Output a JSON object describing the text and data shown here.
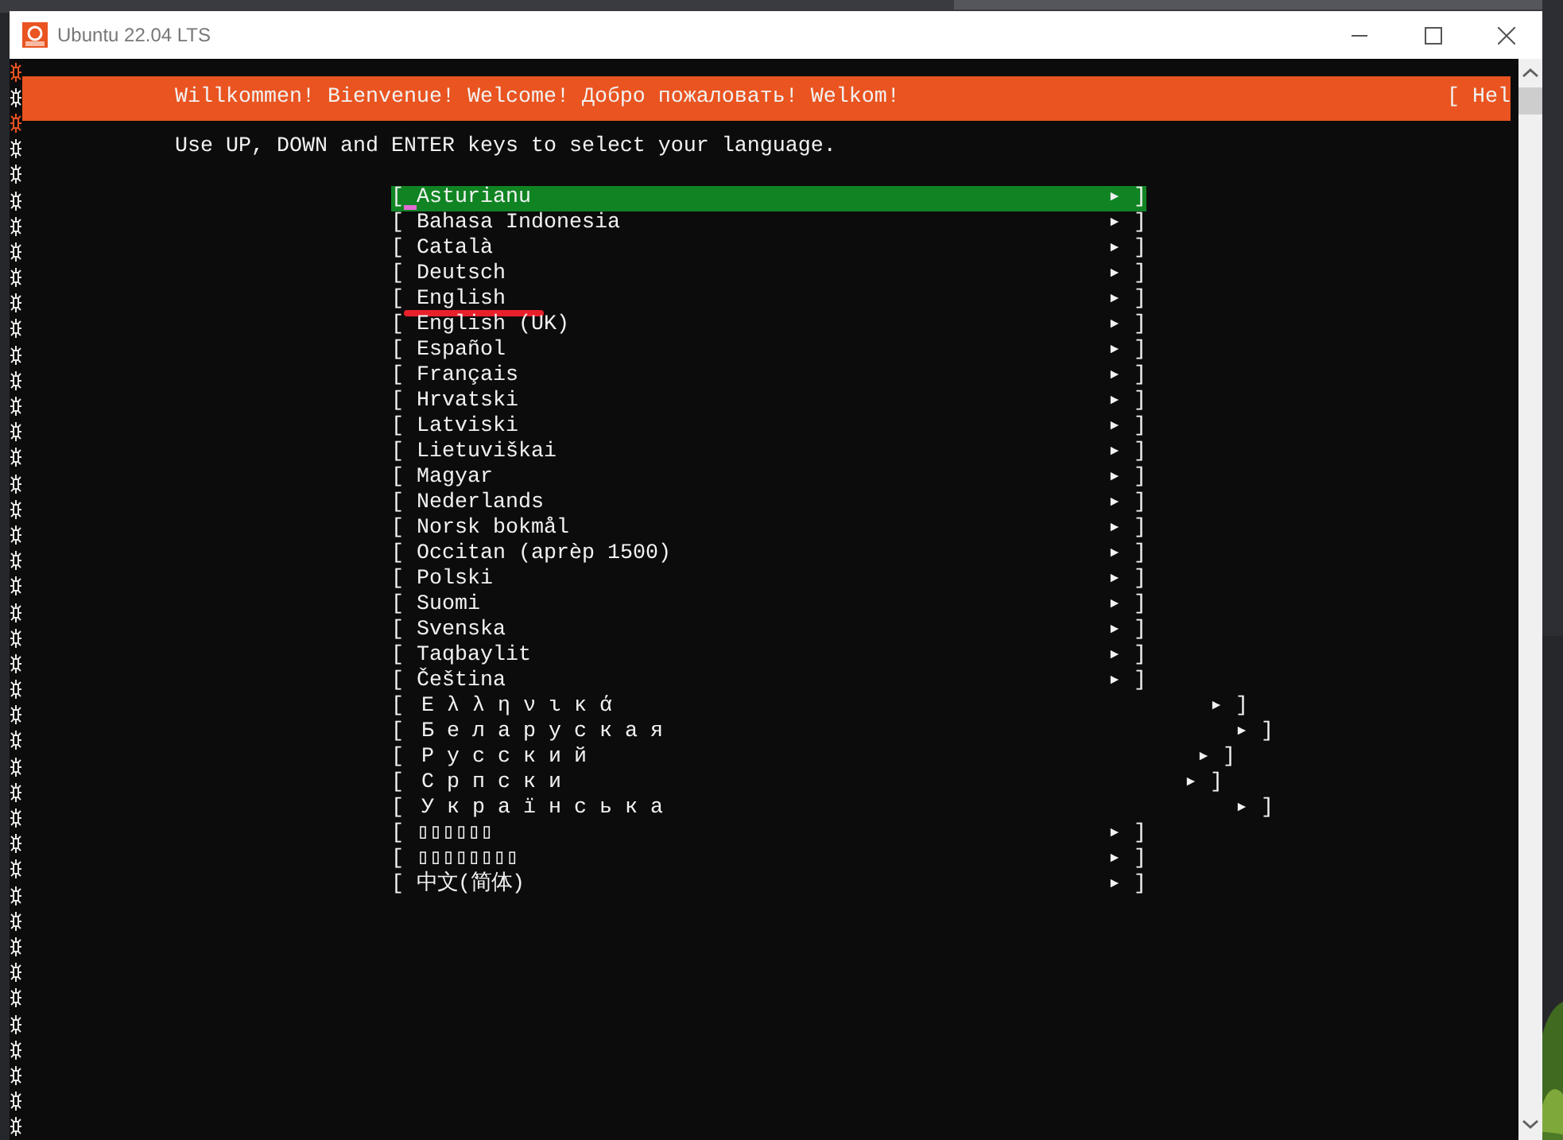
{
  "window": {
    "title": "Ubuntu 22.04 LTS"
  },
  "header": {
    "text": "Willkommen! Bienvenue! Welcome! Добро пожаловать! Welkom!",
    "help": "[ Hel"
  },
  "instruction": "Use UP, DOWN and ENTER keys to select your language.",
  "languages": [
    {
      "left": "[",
      "label": "Asturianu",
      "arrow": "▸",
      "right": "]",
      "kind": "normal",
      "selected": true,
      "underlined": false
    },
    {
      "left": "[",
      "label": "Bahasa Indonesia",
      "arrow": "▸",
      "right": "]",
      "kind": "normal",
      "selected": false,
      "underlined": false
    },
    {
      "left": "[",
      "label": "Català",
      "arrow": "▸",
      "right": "]",
      "kind": "normal",
      "selected": false,
      "underlined": false
    },
    {
      "left": "[",
      "label": "Deutsch",
      "arrow": "▸",
      "right": "]",
      "kind": "normal",
      "selected": false,
      "underlined": false
    },
    {
      "left": "[",
      "label": "English",
      "arrow": "▸",
      "right": "]",
      "kind": "normal",
      "selected": false,
      "underlined": true
    },
    {
      "left": "[",
      "label": "English (UK)",
      "arrow": "▸",
      "right": "]",
      "kind": "normal",
      "selected": false,
      "underlined": false
    },
    {
      "left": "[",
      "label": "Español",
      "arrow": "▸",
      "right": "]",
      "kind": "normal",
      "selected": false,
      "underlined": false
    },
    {
      "left": "[",
      "label": "Français",
      "arrow": "▸",
      "right": "]",
      "kind": "normal",
      "selected": false,
      "underlined": false
    },
    {
      "left": "[",
      "label": "Hrvatski",
      "arrow": "▸",
      "right": "]",
      "kind": "normal",
      "selected": false,
      "underlined": false
    },
    {
      "left": "[",
      "label": "Latviski",
      "arrow": "▸",
      "right": "]",
      "kind": "normal",
      "selected": false,
      "underlined": false
    },
    {
      "left": "[",
      "label": "Lietuviškai",
      "arrow": "▸",
      "right": "]",
      "kind": "normal",
      "selected": false,
      "underlined": false
    },
    {
      "left": "[",
      "label": "Magyar",
      "arrow": "▸",
      "right": "]",
      "kind": "normal",
      "selected": false,
      "underlined": false
    },
    {
      "left": "[",
      "label": "Nederlands",
      "arrow": "▸",
      "right": "]",
      "kind": "normal",
      "selected": false,
      "underlined": false
    },
    {
      "left": "[",
      "label": "Norsk bokmål",
      "arrow": "▸",
      "right": "]",
      "kind": "normal",
      "selected": false,
      "underlined": false
    },
    {
      "left": "[",
      "label": "Occitan (aprèp 1500)",
      "arrow": "▸",
      "right": "]",
      "kind": "normal",
      "selected": false,
      "underlined": false
    },
    {
      "left": "[",
      "label": "Polski",
      "arrow": "▸",
      "right": "]",
      "kind": "normal",
      "selected": false,
      "underlined": false
    },
    {
      "left": "[",
      "label": "Suomi",
      "arrow": "▸",
      "right": "]",
      "kind": "normal",
      "selected": false,
      "underlined": false
    },
    {
      "left": "[",
      "label": "Svenska",
      "arrow": "▸",
      "right": "]",
      "kind": "normal",
      "selected": false,
      "underlined": false
    },
    {
      "left": "[",
      "label": "Taqbaylit",
      "arrow": "▸",
      "right": "]",
      "kind": "normal",
      "selected": false,
      "underlined": false
    },
    {
      "left": "[",
      "label": "Čeština",
      "arrow": "▸",
      "right": "]",
      "kind": "normal",
      "selected": false,
      "underlined": false
    },
    {
      "left": "[",
      "label": "Ελληνικά",
      "arrow": "▸",
      "right": "]",
      "kind": "wide",
      "selected": false,
      "underlined": false
    },
    {
      "left": "[",
      "label": "Беларуская",
      "arrow": "▸",
      "right": "]",
      "kind": "wide",
      "selected": false,
      "underlined": false
    },
    {
      "left": "[",
      "label": "Русский",
      "arrow": "▸",
      "right": "]",
      "kind": "wide",
      "selected": false,
      "underlined": false
    },
    {
      "left": "[",
      "label": "Српски",
      "arrow": "▸",
      "right": "]",
      "kind": "wide",
      "selected": false,
      "underlined": false
    },
    {
      "left": "[",
      "label": "Українська",
      "arrow": "▸",
      "right": "]",
      "kind": "wide",
      "selected": false,
      "underlined": false
    },
    {
      "left": "[",
      "label": "▯▯▯▯▯▯",
      "arrow": "▸",
      "right": "]",
      "kind": "normal",
      "selected": false,
      "underlined": false
    },
    {
      "left": "[",
      "label": "▯▯▯▯▯▯▯▯",
      "arrow": "▸",
      "right": "]",
      "kind": "normal",
      "selected": false,
      "underlined": false
    },
    {
      "left": "[",
      "label": "中文(简体)",
      "arrow": "▸",
      "right": "]",
      "kind": "normal",
      "selected": false,
      "underlined": false
    }
  ]
}
